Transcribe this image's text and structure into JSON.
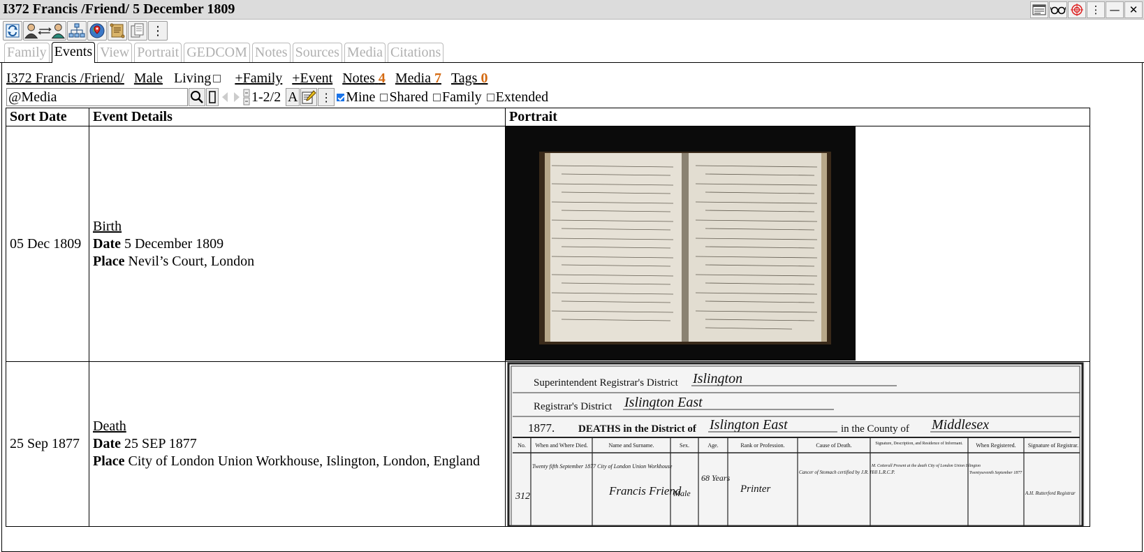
{
  "window": {
    "title": "I372 Francis /Friend/ 5 December 1809",
    "controls": [
      "sheet-icon",
      "glasses-icon",
      "target-icon",
      "kebab-icon",
      "minimize-icon",
      "close-icon"
    ],
    "minimize_glyph": "—",
    "close_glyph": "✕",
    "kebab_glyph": "⋮"
  },
  "toolbar": {
    "buttons": [
      "refresh-icon",
      "swap-people-icon",
      "tree-icon",
      "map-icon",
      "scroll-icon",
      "copy-icon",
      "kebab-icon"
    ],
    "kebab_glyph": "⋮"
  },
  "tabs": [
    {
      "label": "Family",
      "active": false
    },
    {
      "label": "Events",
      "active": true
    },
    {
      "label": "View",
      "active": false
    },
    {
      "label": "Portrait",
      "active": false
    },
    {
      "label": "GEDCOM",
      "active": false
    },
    {
      "label": "Notes",
      "active": false
    },
    {
      "label": "Sources",
      "active": false
    },
    {
      "label": "Media",
      "active": false
    },
    {
      "label": "Citations",
      "active": false
    }
  ],
  "person": {
    "name_link": "I372 Francis /Friend/",
    "sex": "Male",
    "living_label": "Living",
    "add_family": "+Family",
    "add_event": "+Event",
    "notes_label": "Notes",
    "notes_count": "4",
    "media_label": "Media",
    "media_count": "7",
    "tags_label": "Tags",
    "tags_count": "0"
  },
  "filter": {
    "search_value": "@Media",
    "range_text": "1-2/2",
    "font_btn": "A",
    "kebab_glyph": "⋮",
    "checkboxes": [
      {
        "label": "Mine",
        "checked": true
      },
      {
        "label": "Shared",
        "checked": false
      },
      {
        "label": "Family",
        "checked": false
      },
      {
        "label": "Extended",
        "checked": false
      }
    ]
  },
  "table": {
    "headers": [
      "Sort Date",
      "Event Details",
      "Portrait"
    ],
    "rows": [
      {
        "sort_date": "05 Dec 1809",
        "event_type": "Birth",
        "date_label": "Date",
        "date_value": "5 December 1809",
        "place_label": "Place",
        "place_value": "Nevil’s Court, London"
      },
      {
        "sort_date": "25 Sep 1877",
        "event_type": "Death",
        "date_label": "Date",
        "date_value": "25 SEP 1877",
        "place_label": "Place",
        "place_value": "City of London Union Workhouse, Islington, London, England"
      }
    ]
  },
  "certificate": {
    "superintendent": "Superintendent Registrar's District",
    "superintendent_value": "Islington",
    "registrar": "Registrar's District",
    "registrar_value": "Islington East",
    "year": "1877.",
    "deaths_text": "DEATHS in the District of",
    "district_value": "Islington East",
    "county_text": "in the County of",
    "county_value": "Middlesex",
    "columns": [
      "No.",
      "When and Where Died.",
      "Name and Surname.",
      "Sex.",
      "Age.",
      "Rank or Profession.",
      "Cause of Death.",
      "Signature, Description, and Residence of Informant.",
      "When Registered.",
      "Signature of Registrar."
    ],
    "entry_no": "312",
    "entry_when": "Twenty fifth September 1877 City of London Union Workhouse",
    "entry_name": "Francis Friend",
    "entry_sex": "Male",
    "entry_age": "68 Years",
    "entry_rank": "Printer",
    "entry_cause": "Cancer of Stomach certified by J.R. Hill L.R.C.P.",
    "entry_informant": "M. Cotterall Present at the death City of London Union Islington",
    "entry_registered": "Twentyseventh September 1877",
    "entry_registrar": "A.H. Rutterford Registrar"
  },
  "colors": {
    "count_accent": "#d46a12",
    "tab_disabled": "#b0b0b0",
    "checkbox_checked": "#1a73e8"
  }
}
